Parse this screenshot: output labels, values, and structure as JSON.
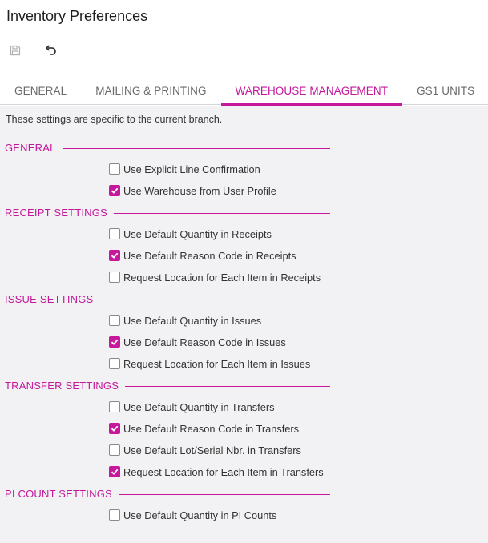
{
  "page": {
    "title": "Inventory Preferences"
  },
  "toolbar": {
    "save_icon": "save-icon",
    "undo_icon": "undo-icon"
  },
  "tabs": [
    {
      "label": "GENERAL",
      "active": false
    },
    {
      "label": "MAILING & PRINTING",
      "active": false
    },
    {
      "label": "WAREHOUSE MANAGEMENT",
      "active": true
    },
    {
      "label": "GS1 UNITS",
      "active": false
    }
  ],
  "note": "These settings are specific to the current branch.",
  "colors": {
    "accent": "#c5189b",
    "panel_bg": "#f2f2f4"
  },
  "sections": [
    {
      "title": "GENERAL",
      "items": [
        {
          "label": "Use Explicit Line Confirmation",
          "checked": false
        },
        {
          "label": "Use Warehouse from User Profile",
          "checked": true
        }
      ]
    },
    {
      "title": "RECEIPT SETTINGS",
      "items": [
        {
          "label": "Use Default Quantity in Receipts",
          "checked": false
        },
        {
          "label": "Use Default Reason Code in Receipts",
          "checked": true
        },
        {
          "label": "Request Location for Each Item in Receipts",
          "checked": false
        }
      ]
    },
    {
      "title": "ISSUE SETTINGS",
      "items": [
        {
          "label": "Use Default Quantity in Issues",
          "checked": false
        },
        {
          "label": "Use Default Reason Code in Issues",
          "checked": true
        },
        {
          "label": "Request Location for Each Item in Issues",
          "checked": false
        }
      ]
    },
    {
      "title": "TRANSFER SETTINGS",
      "items": [
        {
          "label": "Use Default Quantity in Transfers",
          "checked": false
        },
        {
          "label": "Use Default Reason Code in Transfers",
          "checked": true
        },
        {
          "label": "Use Default Lot/Serial Nbr. in Transfers",
          "checked": false
        },
        {
          "label": "Request Location for Each Item in Transfers",
          "checked": true
        }
      ]
    },
    {
      "title": "PI COUNT SETTINGS",
      "items": [
        {
          "label": "Use Default Quantity in PI Counts",
          "checked": false
        }
      ]
    }
  ]
}
